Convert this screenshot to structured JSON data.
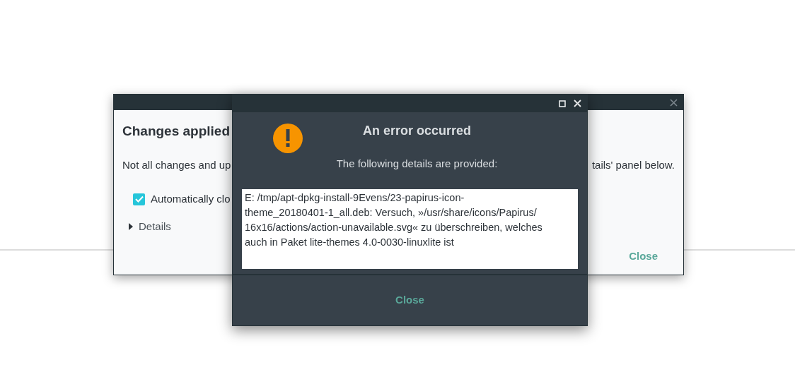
{
  "back_dialog": {
    "title": "Changes applied",
    "message_start": "Not all changes and up",
    "message_end": "tails' panel below.",
    "checkbox": {
      "label": "Automatically clo",
      "checked": true
    },
    "details": {
      "label": "Details",
      "expanded": false
    },
    "close_button": "Close"
  },
  "error_dialog": {
    "title": "An error occurred",
    "subtitle": "The following details are provided:",
    "details_lines": [
      "E: /tmp/apt-dpkg-install-9Evens/23-papirus-icon-",
      "theme_20180401-1_all.deb: Versuch, »/usr/share/icons/Papirus/",
      "16x16/actions/action-unavailable.svg« zu überschreiben, welches",
      "auch in Paket lite-themes 4.0-0030-linuxlite ist"
    ],
    "close_button": "Close"
  }
}
